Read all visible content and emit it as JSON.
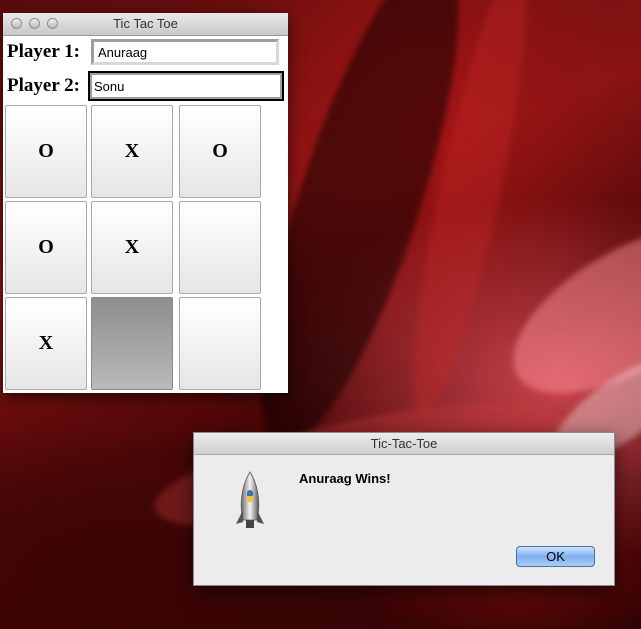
{
  "game_window": {
    "title": "Tic Tac Toe",
    "player1_label": "Player 1:",
    "player1_value": "Anuraag",
    "player2_label": "Player 2:",
    "player2_value": "Sonu",
    "board": [
      "O",
      "X",
      "O",
      "O",
      "X",
      "",
      "X",
      "",
      ""
    ]
  },
  "dialog": {
    "title": "Tic-Tac-Toe",
    "message": "Anuraag Wins!",
    "ok_label": "OK",
    "icon": "python-rocket-icon"
  },
  "colors": {
    "ok_button": "#7fb0ee",
    "wallpaper": "#8a1414"
  }
}
